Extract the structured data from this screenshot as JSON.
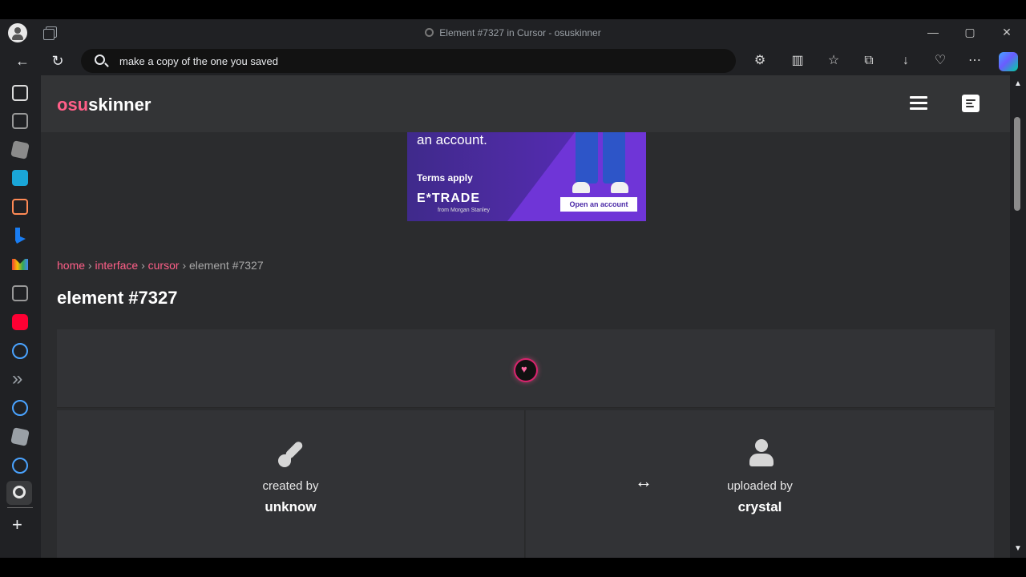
{
  "browser": {
    "window_title": "Element #7327 in Cursor - osuskinner",
    "address_text": "make a copy of the one you saved",
    "window_controls": [
      "—",
      "▢",
      "✕"
    ],
    "toolbar_icons": [
      "puzzle-icon",
      "split-screen-icon",
      "favorites-icon",
      "collections-icon",
      "downloads-icon",
      "browser-essentials-icon",
      "more-icon",
      "copilot-icon"
    ],
    "sidebar_icons": [
      "page-icon",
      "document-icon",
      "game-icon",
      "tr-icon",
      "briefcase-icon",
      "bing-icon",
      "gmail-icon",
      "document-icon",
      "youtube-icon",
      "search-icon",
      "double-chevron-icon",
      "search-icon",
      "roblox-icon",
      "search-icon",
      "osuskinner-icon",
      "add-icon"
    ]
  },
  "site": {
    "logo_prefix": "osu",
    "logo_suffix": "skinner",
    "ad": {
      "headline": "an account.",
      "terms": "Terms apply",
      "brand": "E*TRADE",
      "brand_sub": "from Morgan Stanley",
      "button": "Open an account"
    },
    "breadcrumb": {
      "home": "home",
      "sep1": "›",
      "interface": "interface",
      "sep2": "›",
      "cursor": "cursor",
      "sep3": "›",
      "current": "element #7327"
    },
    "title": "element #7327",
    "created": {
      "label": "created by",
      "value": "unknow"
    },
    "uploaded": {
      "label": "uploaded by",
      "value": "crystal"
    }
  }
}
